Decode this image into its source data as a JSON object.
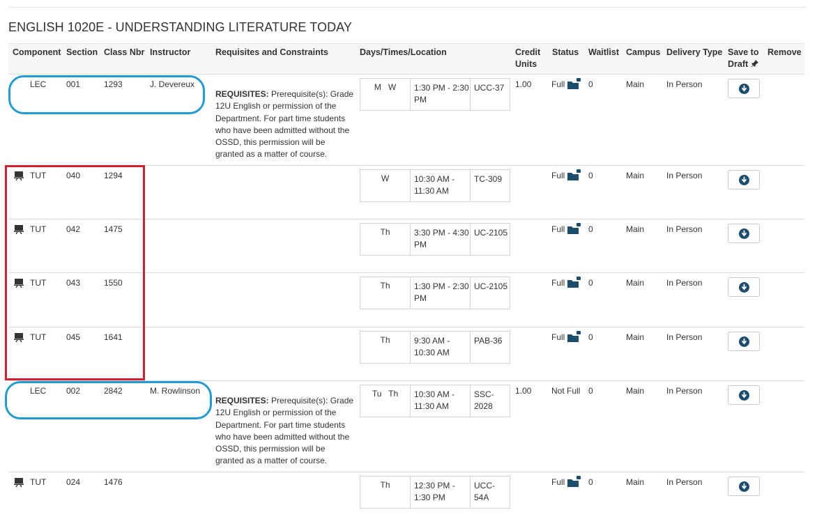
{
  "course": {
    "title": "ENGLISH 1020E - UNDERSTANDING LITERATURE TODAY"
  },
  "headers": {
    "component": "Component",
    "section": "Section",
    "class_nbr": "Class Nbr",
    "instructor": "Instructor",
    "requisites": "Requisites and Constraints",
    "days_times_location": "Days/Times/Location",
    "credit_units": [
      "Credit",
      "Units"
    ],
    "status": "Status",
    "waitlist": "Waitlist",
    "campus": "Campus",
    "delivery_type": "Delivery Type",
    "save_to_draft": [
      "Save to",
      "Draft"
    ],
    "remove": "Remove"
  },
  "requisites_label": "REQUISITES:",
  "requisites_text": "Prerequisite(s): Grade 12U English or permission of the Department. For part time students who have been admitted without the OSSD, this permission will be granted as a matter of course.",
  "rows": [
    {
      "component": "LEC",
      "section": "001",
      "class_nbr": "1293",
      "instructor": "J. Devereux",
      "has_requisites": true,
      "days": "M   W",
      "times": "1:30 PM - 2:30 PM",
      "location": "UCC-37",
      "credit": "1.00",
      "status": "Full",
      "waitlist": "0",
      "campus": "Main",
      "delivery": "In Person",
      "icon": "none",
      "locked": true
    },
    {
      "component": "TUT",
      "section": "040",
      "class_nbr": "1294",
      "instructor": "",
      "has_requisites": false,
      "days": "W",
      "times": "10:30 AM - 11:30 AM",
      "location": "TC-309",
      "credit": "",
      "status": "Full",
      "waitlist": "0",
      "campus": "Main",
      "delivery": "In Person",
      "icon": "tutorial-icon",
      "locked": true
    },
    {
      "component": "TUT",
      "section": "042",
      "class_nbr": "1475",
      "instructor": "",
      "has_requisites": false,
      "days": "Th",
      "times": "3:30 PM - 4:30 PM",
      "location": "UC-2105",
      "credit": "",
      "status": "Full",
      "waitlist": "0",
      "campus": "Main",
      "delivery": "In Person",
      "icon": "tutorial-icon",
      "locked": true
    },
    {
      "component": "TUT",
      "section": "043",
      "class_nbr": "1550",
      "instructor": "",
      "has_requisites": false,
      "days": "Th",
      "times": "1:30 PM - 2:30 PM",
      "location": "UC-2105",
      "credit": "",
      "status": "Full",
      "waitlist": "0",
      "campus": "Main",
      "delivery": "In Person",
      "icon": "tutorial-icon",
      "locked": true
    },
    {
      "component": "TUT",
      "section": "045",
      "class_nbr": "1641",
      "instructor": "",
      "has_requisites": false,
      "days": "Th",
      "times": "9:30 AM - 10:30 AM",
      "location": "PAB-36",
      "credit": "",
      "status": "Full",
      "waitlist": "0",
      "campus": "Main",
      "delivery": "In Person",
      "icon": "tutorial-icon",
      "locked": true
    },
    {
      "component": "LEC",
      "section": "002",
      "class_nbr": "2842",
      "instructor": "M. Rowlinson",
      "has_requisites": true,
      "days": "Tu   Th",
      "times": "10:30 AM - 11:30 AM",
      "location": "SSC-2028",
      "credit": "1.00",
      "status": "Not Full",
      "waitlist": "0",
      "campus": "Main",
      "delivery": "In Person",
      "icon": "none",
      "locked": false
    },
    {
      "component": "TUT",
      "section": "024",
      "class_nbr": "1476",
      "instructor": "",
      "has_requisites": false,
      "days": "Th",
      "times": "12:30 PM - 1:30 PM",
      "location": "UCC-54A",
      "credit": "",
      "status": "Full",
      "waitlist": "0",
      "campus": "Main",
      "delivery": "In Person",
      "icon": "tutorial-icon",
      "locked": true
    }
  ],
  "colors": {
    "accent": "#1d4d6e",
    "highlight_blue": "#1f9bd6",
    "highlight_red": "#d4202a"
  }
}
